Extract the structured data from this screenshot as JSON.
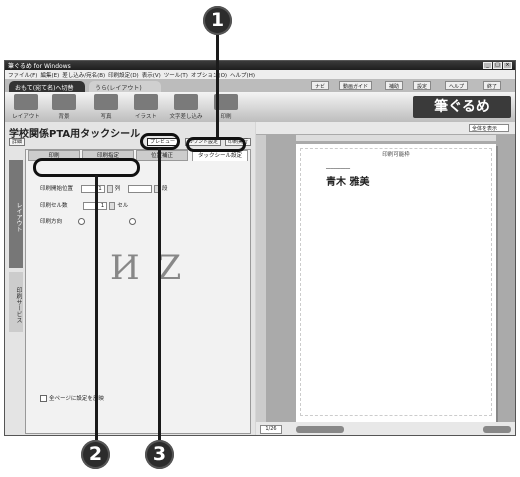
{
  "window": {
    "title": "筆ぐるめ for Windows"
  },
  "menu": [
    "ファイル(F)",
    "編集(E)",
    "差し込み/宛名(B)",
    "印刷設定(D)",
    "表示(V)",
    "ツール(T)",
    "オプション(O)",
    "ヘルプ(H)"
  ],
  "tabs": [
    "おもて(宛て名)へ切替",
    "うら(レイアウト)"
  ],
  "ribbon_buttons": [
    "ナビ",
    "動画ガイド",
    "補助",
    "設定",
    "ヘルプ",
    "終了"
  ],
  "toolbar": [
    "レイアウト",
    "背景",
    "写真",
    "イラスト",
    "文字差し込み",
    "印刷"
  ],
  "brand": "筆ぐるめ",
  "doc_title": "学校関係PTA用タックシール",
  "subbar": {
    "view": "詳細",
    "preview": "プレビュー",
    "count": "カウント設定",
    "print": "印刷実行"
  },
  "panel_tabs": [
    "印刷",
    "印刷指定",
    "位置補正",
    "タックシール設定"
  ],
  "panel": {
    "start_label": "印刷開始位置",
    "start_value": "1",
    "col_unit": "列",
    "row_unit": "段",
    "copies_label": "印刷セル数",
    "copies_value": "1",
    "copies_unit": "セル",
    "dir_label": "印刷方向",
    "chk_label": "全ページに設定を反映"
  },
  "side_tabs": [
    "レイアウト",
    "印刷サービス"
  ],
  "preview": {
    "zoom": "全体を表示",
    "page_title": "印刷可能枠",
    "name": "青木 雅美",
    "page": "1/26"
  },
  "markers": [
    "1",
    "2",
    "3"
  ]
}
